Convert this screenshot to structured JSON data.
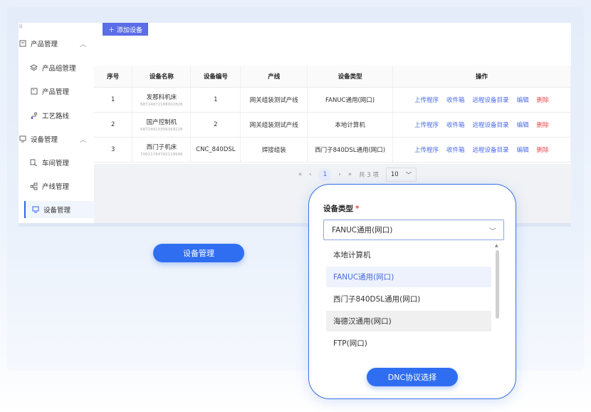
{
  "colors": {
    "accent": "#2f6ef0",
    "add_button": "#5b6de8",
    "link": "#4a69e8",
    "danger": "#e84a4a"
  },
  "toolbar": {
    "add_label": "添加设备",
    "add_icon": "plus-icon"
  },
  "sidebar": {
    "hidden_top": "设",
    "product_group": {
      "label": "产品管理",
      "icon": "product-icon"
    },
    "product_items": [
      {
        "label": "产品组管理",
        "icon": "layers-icon"
      },
      {
        "label": "产品管理",
        "icon": "box-icon"
      },
      {
        "label": "工艺路线",
        "icon": "route-icon"
      }
    ],
    "device_group": {
      "label": "设备管理",
      "icon": "device-icon"
    },
    "device_items": [
      {
        "label": "车间管理",
        "icon": "workshop-icon"
      },
      {
        "label": "产线管理",
        "icon": "line-icon"
      },
      {
        "label": "设备管理",
        "icon": "device-icon"
      }
    ]
  },
  "table": {
    "headers": [
      "序号",
      "设备名称",
      "设备编号",
      "产线",
      "设备类型",
      "操作"
    ],
    "rows": [
      {
        "index": "1",
        "name": "发那科机床",
        "sn": "6872487218800282​6",
        "code": "1",
        "line": "网关组装测试产线",
        "type": "FANUC通用(网口)"
      },
      {
        "index": "2",
        "name": "国产控制机",
        "sn": "68724910356169226",
        "code": "2",
        "line": "网关组装测试产线",
        "type": "本地计算机"
      },
      {
        "index": "3",
        "name": "西门子机床",
        "sn": "70021764742119946",
        "code": "CNC_840DSL",
        "line": "焊接组装",
        "type": "西门子840DSL通用(网口)"
      }
    ],
    "ops": [
      "上传程序",
      "收件箱",
      "远程设备目录",
      "编辑",
      "删除"
    ]
  },
  "pager": {
    "first": "«",
    "prev": "‹",
    "current": "1",
    "next": "›",
    "last": "»",
    "total": "共 3 项",
    "page_size": "10"
  },
  "bottom": {
    "device_mgmt_button": "设备管理",
    "dnc_button": "DNC协议选择"
  },
  "zoom": {
    "label": "设备类型",
    "required": "*",
    "selected": "FANUC通用(网口)",
    "options": [
      "本地计算机",
      "FANUC通用(网口)",
      "西门子840DSL通用(网口)",
      "海德汉通用(网口)",
      "FTP(网口)"
    ]
  }
}
